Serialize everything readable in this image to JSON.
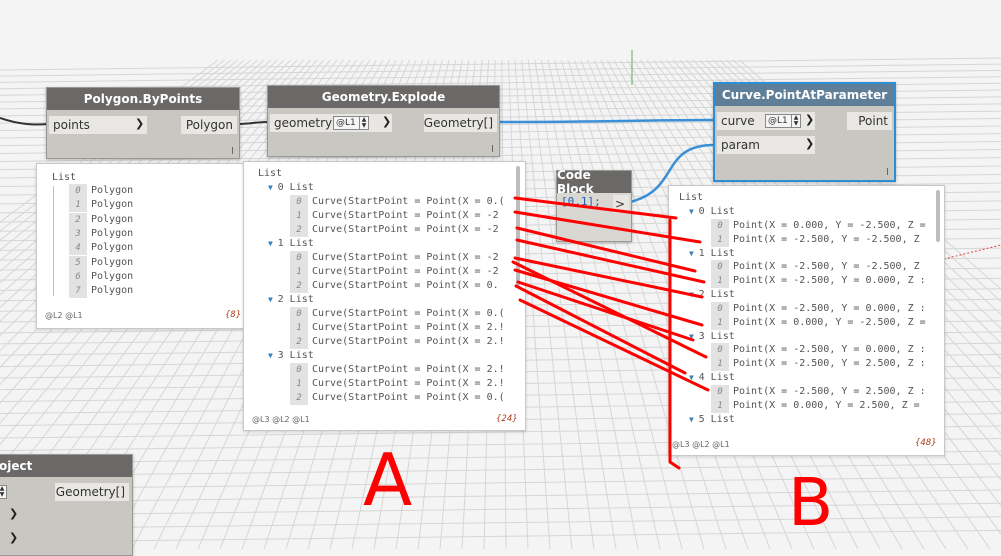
{
  "nodes": {
    "polygon_by_points": {
      "title": "Polygon.ByPoints",
      "input": "points",
      "output": "Polygon",
      "preview": {
        "header": "List",
        "items": [
          {
            "index": "0",
            "value": "Polygon"
          },
          {
            "index": "1",
            "value": "Polygon"
          },
          {
            "index": "2",
            "value": "Polygon"
          },
          {
            "index": "3",
            "value": "Polygon"
          },
          {
            "index": "4",
            "value": "Polygon"
          },
          {
            "index": "5",
            "value": "Polygon"
          },
          {
            "index": "6",
            "value": "Polygon"
          },
          {
            "index": "7",
            "value": "Polygon"
          }
        ],
        "levels": "@L2 @L1",
        "count": "{8}"
      }
    },
    "geometry_explode": {
      "title": "Geometry.Explode",
      "input": "geometry",
      "lacing": "@L1",
      "output": "Geometry[]",
      "preview": {
        "header": "List",
        "groups": [
          {
            "label": "0 List",
            "items": [
              {
                "index": "0",
                "value": "Curve(StartPoint = Point(X = 0.("
              },
              {
                "index": "1",
                "value": "Curve(StartPoint = Point(X = -2"
              },
              {
                "index": "2",
                "value": "Curve(StartPoint = Point(X = -2"
              }
            ]
          },
          {
            "label": "1 List",
            "items": [
              {
                "index": "0",
                "value": "Curve(StartPoint = Point(X = -2"
              },
              {
                "index": "1",
                "value": "Curve(StartPoint = Point(X = -2"
              },
              {
                "index": "2",
                "value": "Curve(StartPoint = Point(X = 0."
              }
            ]
          },
          {
            "label": "2 List",
            "items": [
              {
                "index": "0",
                "value": "Curve(StartPoint = Point(X = 0.("
              },
              {
                "index": "1",
                "value": "Curve(StartPoint = Point(X = 2.!"
              },
              {
                "index": "2",
                "value": "Curve(StartPoint = Point(X = 2.!"
              }
            ]
          },
          {
            "label": "3 List",
            "items": [
              {
                "index": "0",
                "value": "Curve(StartPoint = Point(X = 2.!"
              },
              {
                "index": "1",
                "value": "Curve(StartPoint = Point(X = 2.!"
              },
              {
                "index": "2",
                "value": "Curve(StartPoint = Point(X = 0.("
              }
            ]
          }
        ],
        "levels": "@L3 @L2 @L1",
        "count": "{24}"
      }
    },
    "code_block": {
      "title": "Code Block",
      "code": "[0,1];",
      "output": ">"
    },
    "curve_point_at_parameter": {
      "title": "Curve.PointAtParameter",
      "input_curve": "curve",
      "lacing": "@L1",
      "input_param": "param",
      "output": "Point",
      "preview": {
        "header": "List",
        "groups": [
          {
            "label": "0 List",
            "items": [
              {
                "index": "0",
                "value": "Point(X = 0.000, Y = -2.500, Z ="
              },
              {
                "index": "1",
                "value": "Point(X = -2.500, Y = -2.500, Z"
              }
            ]
          },
          {
            "label": "1 List",
            "items": [
              {
                "index": "0",
                "value": "Point(X = -2.500, Y = -2.500, Z"
              },
              {
                "index": "1",
                "value": "Point(X = -2.500, Y = 0.000, Z :"
              }
            ]
          },
          {
            "label": "2 List",
            "items": [
              {
                "index": "0",
                "value": "Point(X = -2.500, Y = 0.000, Z :"
              },
              {
                "index": "1",
                "value": "Point(X = 0.000, Y = -2.500, Z ="
              }
            ]
          },
          {
            "label": "3 List",
            "items": [
              {
                "index": "0",
                "value": "Point(X = -2.500, Y = 0.000, Z :"
              },
              {
                "index": "1",
                "value": "Point(X = -2.500, Y = 2.500, Z :"
              }
            ]
          },
          {
            "label": "4 List",
            "items": [
              {
                "index": "0",
                "value": "Point(X = -2.500, Y = 2.500, Z :"
              },
              {
                "index": "1",
                "value": "Point(X = 0.000, Y = 2.500, Z ="
              }
            ]
          },
          {
            "label": "5 List",
            "items": []
          }
        ],
        "levels": "@L3 @L2 @L1",
        "count": "{48}"
      }
    },
    "partial_object_node": {
      "title": "oject",
      "output": "Geometry[]"
    }
  },
  "annotations": {
    "label_a": "A",
    "label_b": "B",
    "color": "#ff0000"
  },
  "colors": {
    "wire": "#3a8fd6",
    "node_header": "#6b6967",
    "node_header_blue": "#5f7f99",
    "selection": "#2c8fd6"
  }
}
